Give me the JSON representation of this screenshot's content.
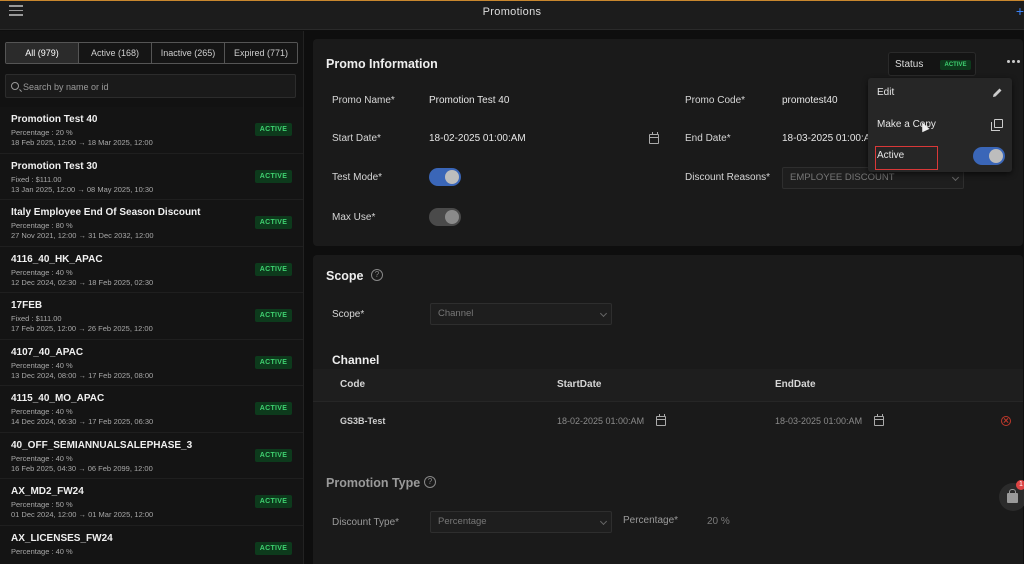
{
  "topbar": {
    "title": "Promotions"
  },
  "filters": {
    "all": "All (979)",
    "active": "Active (168)",
    "inactive": "Inactive (265)",
    "expired": "Expired (771)"
  },
  "search": {
    "placeholder": "Search by name or id"
  },
  "promotions": [
    {
      "name": "Promotion Test 40",
      "type": "Percentage : 20 %",
      "dates": "18 Feb 2025, 12:00 → 18 Mar 2025, 12:00",
      "status": "ACTIVE"
    },
    {
      "name": "Promotion Test 30",
      "type": "Fixed : $111.00",
      "dates": "13 Jan 2025, 12:00 → 08 May 2025, 10:30",
      "status": "ACTIVE"
    },
    {
      "name": "Italy Employee End Of Season Discount",
      "type": "Percentage : 80 %",
      "dates": "27 Nov 2021, 12:00 → 31 Dec 2032, 12:00",
      "status": "ACTIVE"
    },
    {
      "name": "4116_40_HK_APAC",
      "type": "Percentage : 40 %",
      "dates": "12 Dec 2024, 02:30 → 18 Feb 2025, 02:30",
      "status": "ACTIVE"
    },
    {
      "name": "17FEB",
      "type": "Fixed : $111.00",
      "dates": "17 Feb 2025, 12:00 → 26 Feb 2025, 12:00",
      "status": "ACTIVE"
    },
    {
      "name": "4107_40_APAC",
      "type": "Percentage : 40 %",
      "dates": "13 Dec 2024, 08:00 → 17 Feb 2025, 08:00",
      "status": "ACTIVE"
    },
    {
      "name": "4115_40_MO_APAC",
      "type": "Percentage : 40 %",
      "dates": "14 Dec 2024, 06:30 → 17 Feb 2025, 06:30",
      "status": "ACTIVE"
    },
    {
      "name": "40_OFF_SEMIANNUALSALEPHASE_3",
      "type": "Percentage : 40 %",
      "dates": "16 Feb 2025, 04:30 → 06 Feb 2099, 12:00",
      "status": "ACTIVE"
    },
    {
      "name": "AX_MD2_FW24",
      "type": "Percentage : 50 %",
      "dates": "01 Dec 2024, 12:00 → 01 Mar 2025, 12:00",
      "status": "ACTIVE"
    },
    {
      "name": "AX_LICENSES_FW24",
      "type": "Percentage : 40 %",
      "dates": "",
      "status": "ACTIVE"
    }
  ],
  "promo_info": {
    "title": "Promo Information",
    "status_label": "Status",
    "status_badge": "ACTIVE",
    "promo_name_label": "Promo Name*",
    "promo_name_value": "Promotion Test 40",
    "promo_code_label": "Promo Code*",
    "promo_code_value": "promotest40",
    "start_date_label": "Start Date*",
    "start_date_value": "18-02-2025 01:00:AM",
    "end_date_label": "End Date*",
    "end_date_value": "18-03-2025 01:00:A",
    "test_mode_label": "Test Mode*",
    "test_mode_on": true,
    "discount_reasons_label": "Discount Reasons*",
    "discount_reasons_value": "EMPLOYEE DISCOUNT",
    "max_use_label": "Max Use*",
    "max_use_on": false
  },
  "menu": {
    "edit": "Edit",
    "copy": "Make a Copy",
    "active": "Active",
    "active_on": true
  },
  "scope": {
    "title": "Scope",
    "help": "?",
    "scope_label": "Scope*",
    "scope_value": "Channel",
    "channel_title": "Channel",
    "columns": [
      "Code",
      "StartDate",
      "EndDate"
    ],
    "rows": [
      {
        "code": "GS3B-Test",
        "start": "18-02-2025 01:00:AM",
        "end": "18-03-2025 01:00:AM"
      }
    ]
  },
  "promotion_type": {
    "title": "Promotion Type",
    "help": "?",
    "discount_type_label": "Discount Type*",
    "discount_type_value": "Percentage",
    "percentage_label": "Percentage*",
    "percentage_value": "20 %"
  },
  "fab": {
    "badge": "1"
  },
  "colors": {
    "accent": "#3a66b8",
    "active_badge_bg": "#0d3a1c",
    "active_badge_fg": "#3fd170",
    "danger": "#d93838"
  }
}
